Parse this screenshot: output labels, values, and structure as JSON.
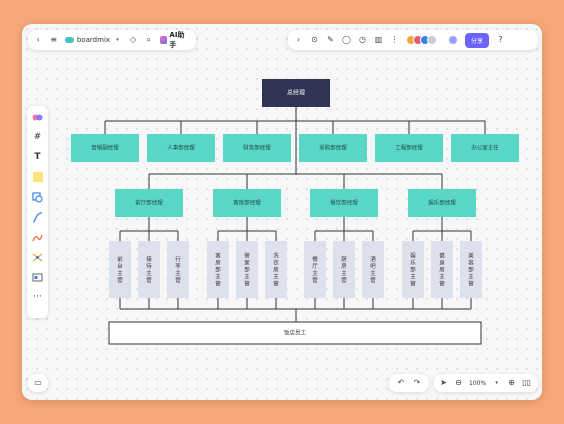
{
  "toolbar_left": {
    "brand": "boardmix",
    "ai_label": "AI助手"
  },
  "toolbar_right": {
    "share_label": "分享",
    "avatar_colors": [
      "#f2a93b",
      "#e45b7a",
      "#3d7ff0",
      "#9aa0ff"
    ]
  },
  "zoom": {
    "level": "100%"
  },
  "colors": {
    "root_fill": "#2f3453",
    "dept_fill": "#5ad6c6",
    "unit_fill": "#dde1ee",
    "accent": "#6c63ff",
    "line": "#333333"
  },
  "orgchart": {
    "root": "总经理",
    "departments": [
      "营销副经理",
      "人事部经理",
      "财务部经理",
      "采购部经理",
      "工程部经理",
      "办公室主任"
    ],
    "managers": [
      "前厅部经理",
      "客房部经理",
      "餐饮部经理",
      "娱乐部经理"
    ],
    "units": [
      [
        "前台主管",
        "接待主管",
        "行李主管"
      ],
      [
        "客房部主管",
        "管家部主管",
        "洗衣房主管"
      ],
      [
        "餐厅主管",
        "厨房主管",
        "酒吧主管"
      ],
      [
        "娱乐部主管",
        "健身房主管",
        "美容部主管"
      ]
    ],
    "staff": "饭店员工"
  }
}
